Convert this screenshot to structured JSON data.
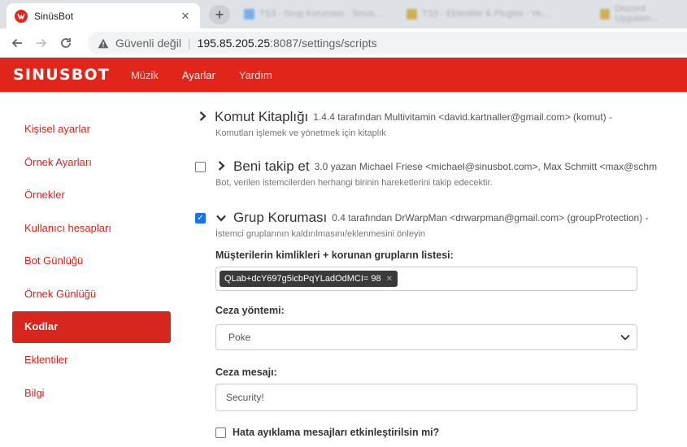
{
  "browser": {
    "tab_title": "SinüsBot",
    "tab_close": "✕",
    "new_tab": "+",
    "bg_tabs": [
      "TS3 · Grup Koruması · Sinüs...",
      "TS3 - Eklentiler & Plugins - Ye...",
      "Discord Uygulam..."
    ],
    "security_label": "Güvenli değil",
    "url_host": "195.85.205.25",
    "url_path": ":8087/settings/scripts"
  },
  "app": {
    "logo": "SINUSBOT",
    "nav": [
      "Müzik",
      "Ayarlar",
      "Yardım"
    ],
    "brand_color": "#e1251b"
  },
  "sidebar": {
    "items": [
      {
        "label": "Kişisel ayarlar"
      },
      {
        "label": "Örnek Ayarları"
      },
      {
        "label": "Örnekler"
      },
      {
        "label": "Kullanıcı hesapları"
      },
      {
        "label": "Bot Günlüğü"
      },
      {
        "label": "Örnek Günlüğü"
      },
      {
        "label": "Kodlar"
      },
      {
        "label": "Eklentiler"
      },
      {
        "label": "Bilgi"
      }
    ],
    "active": "Kodlar"
  },
  "scripts": [
    {
      "title": "Komut Kitaplığı",
      "meta": "1.4.4 tarafından Multivitamin <david.kartnaller@gmail.com> (komut) -",
      "desc": "Komutları işlemek ve yönetmek için kitaplık",
      "has_checkbox": false,
      "expanded": false
    },
    {
      "title": "Beni takip et",
      "meta": "3.0 yazan Michael Friese <michael@sinusbot.com>, Max Schmitt <max@schm",
      "desc": "Bot, verilen istemcilerden herhangi birinin hareketlerini takip edecektir.",
      "has_checkbox": true,
      "checked": false,
      "expanded": false
    },
    {
      "title": "Grup Koruması",
      "meta": "0.4 tarafından DrWarpMan <drwarpman@gmail.com> (groupProtection) -",
      "desc": "İstemci gruplarının kaldırılmasını/eklenmesini önleyin",
      "has_checkbox": true,
      "checked": true,
      "expanded": true
    }
  ],
  "settings": {
    "clients_label": "Müşterilerin kimlikleri + korunan grupların listesi:",
    "clients_tag": "QLab+dcY697g5icbPqYLadOdMCI= 98",
    "punishment_label": "Ceza yöntemi:",
    "punishment_value": "Poke",
    "message_label": "Ceza mesajı:",
    "message_value": "Security!",
    "debug_label": "Hata ayıklama mesajları etkinleştirilsin mi?",
    "debug_checked": false
  }
}
